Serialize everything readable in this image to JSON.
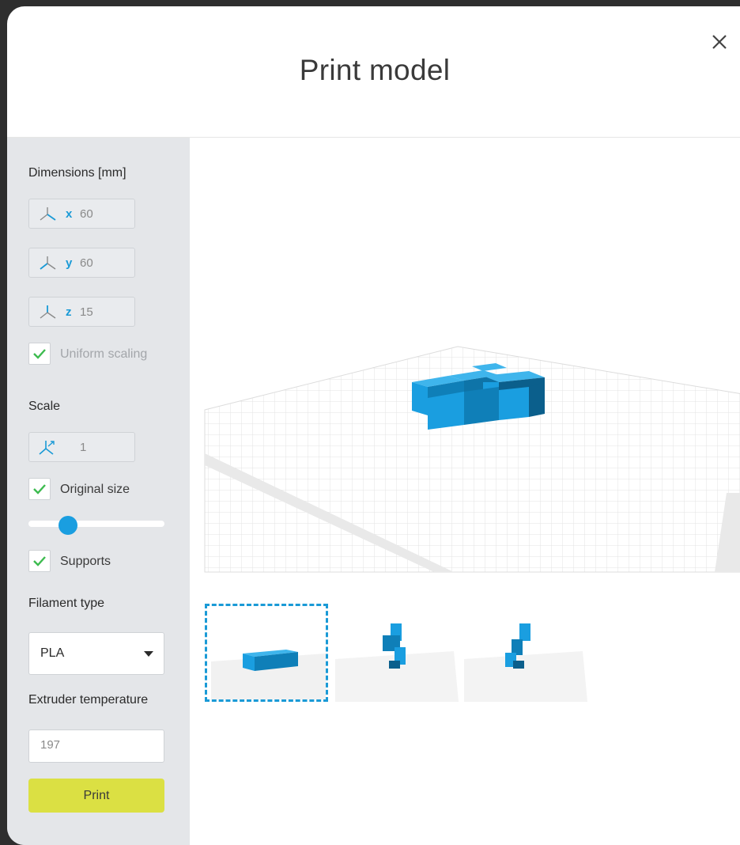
{
  "dialog": {
    "title": "Print model",
    "close_icon": "close-icon"
  },
  "dimensions": {
    "label": "Dimensions [mm]",
    "fields": [
      {
        "axis": "x",
        "value": "60"
      },
      {
        "axis": "y",
        "value": "60"
      },
      {
        "axis": "z",
        "value": "15"
      }
    ],
    "uniform_scaling": {
      "label": "Uniform scaling",
      "checked": true,
      "disabled": true
    }
  },
  "scale": {
    "label": "Scale",
    "value": "1",
    "original_size": {
      "label": "Original size",
      "checked": true
    },
    "slider_fraction": 0.29
  },
  "supports": {
    "label": "Supports",
    "checked": true
  },
  "filament": {
    "label": "Filament type",
    "selected": "PLA"
  },
  "extruder": {
    "label": "Extruder temperature",
    "value": "197"
  },
  "actions": {
    "print_label": "Print"
  },
  "colors": {
    "accent": "#1a9ad6",
    "model": "#1a9ee0",
    "print_button": "#dbe043",
    "sidebar": "#e4e6e9",
    "check": "#3dbb4f"
  },
  "views": [
    {
      "name": "front-view",
      "selected": true
    },
    {
      "name": "side-view",
      "selected": false
    },
    {
      "name": "top-view",
      "selected": false
    }
  ]
}
